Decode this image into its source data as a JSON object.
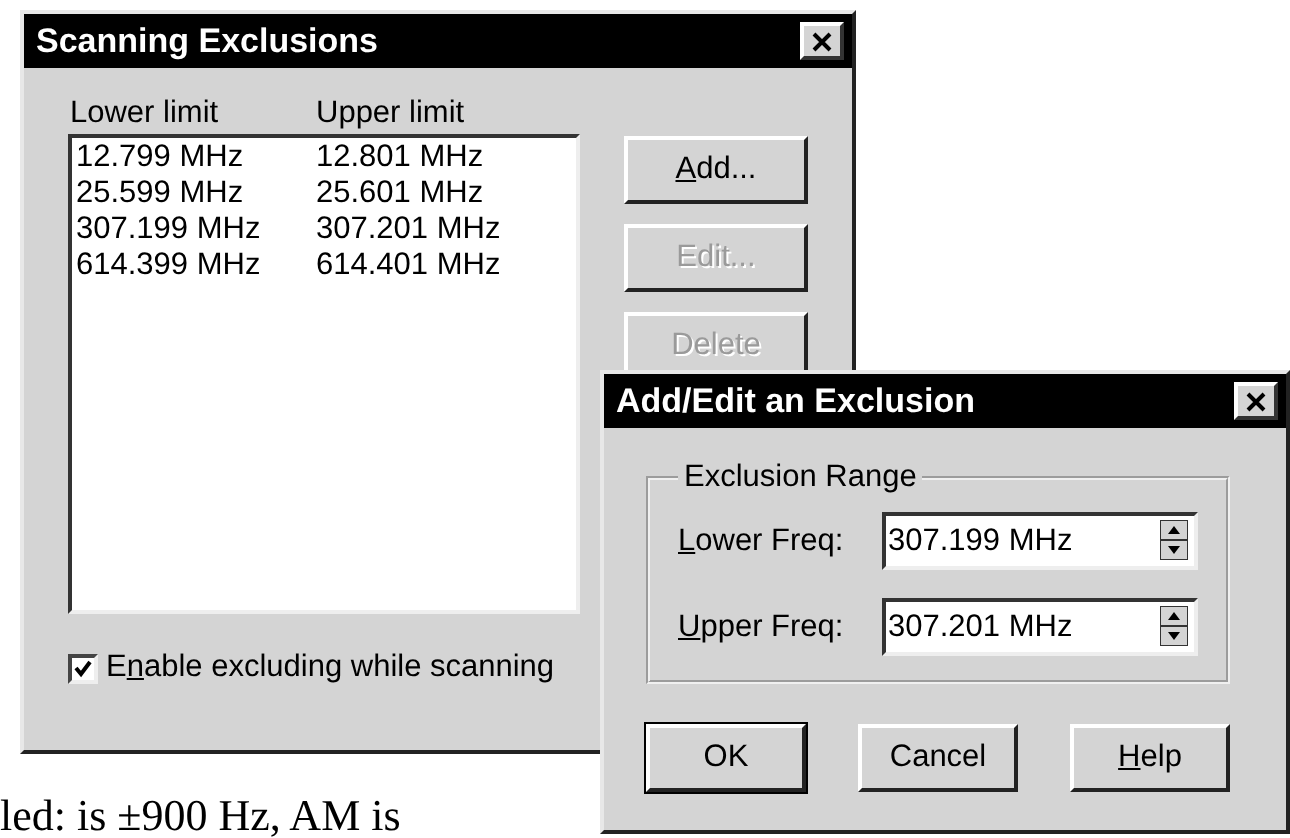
{
  "dialogs": [
    {
      "title": "Scanning Exclusions",
      "kind": "list",
      "columns": [
        "Lower limit",
        "Upper limit"
      ],
      "rows": [
        [
          "12.799 MHz",
          "12.801 MHz"
        ],
        [
          "25.599 MHz",
          "25.601 MHz"
        ],
        [
          "307.199 MHz",
          "307.201 MHz"
        ],
        [
          "614.399 MHz",
          "614.401 MHz"
        ]
      ],
      "buttons": [
        {
          "key": "A",
          "post": "dd...",
          "disabled": false
        },
        {
          "post": "Edit...",
          "disabled": true
        },
        {
          "post": "Delete",
          "disabled": true
        }
      ],
      "checkbox": {
        "pre": "E",
        "key": "n",
        "post": "able excluding while scanning",
        "checked": true
      }
    },
    {
      "title": "Add/Edit an Exclusion",
      "kind": "form",
      "group": "Exclusion Range",
      "fields": [
        {
          "key": "L",
          "post": "ower Freq:",
          "value": "307.199 MHz"
        },
        {
          "key": "U",
          "post": "pper Freq:",
          "value": "307.201 MHz"
        }
      ],
      "buttons": [
        {
          "pre": "OK",
          "disabled": false
        },
        {
          "pre": "Cancel",
          "disabled": false
        },
        {
          "key": "H",
          "post": "elp",
          "disabled": false
        }
      ]
    }
  ],
  "body_text": "led: is ±900 Hz,  AM is"
}
